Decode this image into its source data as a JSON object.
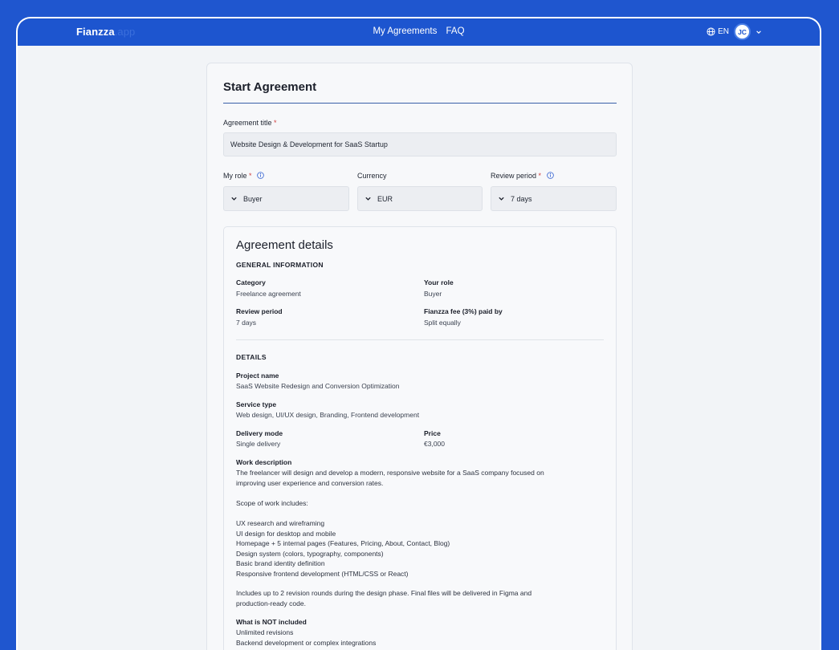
{
  "header": {
    "brand": "Fianzza",
    "brand_tld": ".app",
    "nav": [
      "My Agreements",
      "FAQ"
    ],
    "language": "EN",
    "avatar_initials": "JC"
  },
  "form": {
    "title": "Start Agreement",
    "agreement_title_label": "Agreement title",
    "required_mark": "*",
    "agreement_title_value": "Website Design & Development for SaaS Startup",
    "role_label": "My role",
    "role_value": "Buyer",
    "currency_label": "Currency",
    "currency_value": "EUR",
    "review_label": "Review period",
    "review_value": "7 days"
  },
  "details": {
    "title": "Agreement details",
    "general_heading": "GENERAL INFORMATION",
    "category_label": "Category",
    "category_value": "Freelance agreement",
    "your_role_label": "Your role",
    "your_role_value": "Buyer",
    "review_label": "Review period",
    "review_value": "7 days",
    "fee_label": "Fianzza fee (3%) paid by",
    "fee_value": "Split equally",
    "details_heading": "DETAILS",
    "project_label": "Project name",
    "project_value": "SaaS Website Redesign and Conversion Optimization",
    "service_label": "Service type",
    "service_value": "Web design, UI/UX design, Branding, Frontend development",
    "delivery_label": "Delivery mode",
    "delivery_value": "Single delivery",
    "price_label": "Price",
    "price_value": "€3,000",
    "work_label": "Work description",
    "work_line1": "The freelancer will design and develop a modern, responsive website for a SaaS company focused on",
    "work_line2": "improving user experience and conversion rates.",
    "scope_intro": "Scope of work includes:",
    "scope_items": [
      "UX research and wireframing",
      "UI design for desktop and mobile",
      "Homepage + 5 internal pages (Features, Pricing, About, Contact, Blog)",
      "Design system (colors, typography, components)",
      "Basic brand identity definition",
      "Responsive frontend development (HTML/CSS or React)"
    ],
    "revision_line1": "Includes up to 2 revision rounds during the design phase. Final files will be delivered in Figma and",
    "revision_line2": "production-ready code.",
    "not_included_label": "What is NOT included",
    "not_included_items": [
      "Unlimited revisions",
      "Backend development or complex integrations"
    ]
  }
}
